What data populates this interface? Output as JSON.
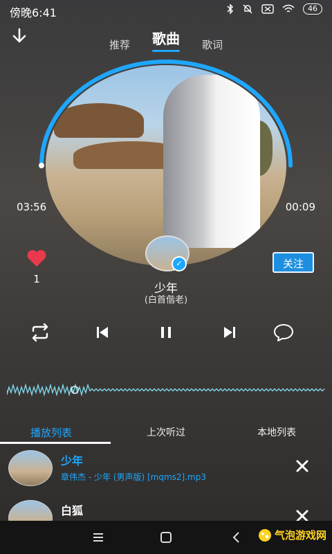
{
  "status": {
    "time": "傍晚6:41",
    "battery": "46"
  },
  "header": {
    "tabs": [
      "推荐",
      "歌曲",
      "歌词"
    ],
    "active_tab": "歌曲"
  },
  "player": {
    "elapsed": "03:56",
    "remaining": "00:09",
    "likes": "1",
    "follow_label": "关注",
    "song_title": "少年",
    "song_subtitle": "(白首偕老)"
  },
  "list_tabs": [
    "播放列表",
    "上次听过",
    "本地列表"
  ],
  "playlist": [
    {
      "title": "少年",
      "meta": "章伟杰 - 少年 (男声版) [mqms2].mp3"
    },
    {
      "title": "白狐",
      "meta": ""
    }
  ],
  "colors": {
    "accent": "#1ea7ff",
    "heart": "#e83a4d",
    "watermark": "#ffd21f"
  },
  "icons": [
    "down-arrow-icon",
    "heart-icon",
    "repeat-icon",
    "previous-icon",
    "pause-icon",
    "next-icon",
    "comment-icon",
    "close-icon",
    "menu-icon",
    "home-icon",
    "back-icon"
  ],
  "watermark": {
    "text": "气泡游戏网",
    "url": "WWW.QPK2B.COM"
  }
}
